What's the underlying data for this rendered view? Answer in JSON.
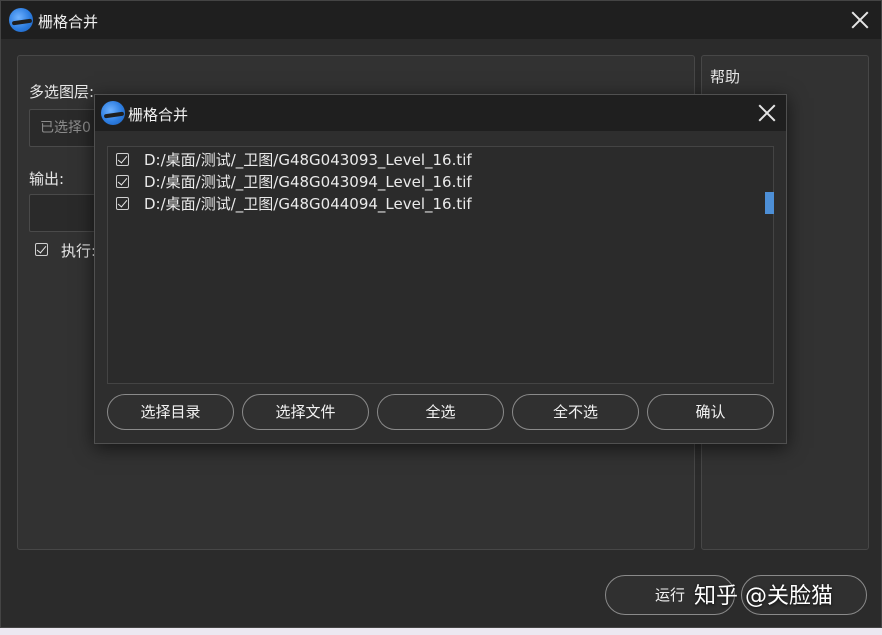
{
  "outer": {
    "title": "栅格合并",
    "label_layers": "多选图层:",
    "selected_text": "已选择0",
    "label_output": "输出:",
    "execute_label": "执行:",
    "help_title": "帮助",
    "run_button": "运行"
  },
  "dialog": {
    "title": "栅格合并",
    "files": [
      {
        "path": "D:/桌面/测试/_卫图/G48G043093_Level_16.tif",
        "checked": true
      },
      {
        "path": "D:/桌面/测试/_卫图/G48G043094_Level_16.tif",
        "checked": true
      },
      {
        "path": "D:/桌面/测试/_卫图/G48G044094_Level_16.tif",
        "checked": true
      }
    ],
    "buttons": {
      "select_dir": "选择目录",
      "select_file": "选择文件",
      "select_all": "全选",
      "select_none": "全不选",
      "confirm": "确认"
    }
  },
  "watermark": "知乎 @关脸猫",
  "colors": {
    "accent": "#4d8fd6",
    "window_bg": "#2b2b2b",
    "titlebar_bg": "#1f1f1f"
  }
}
